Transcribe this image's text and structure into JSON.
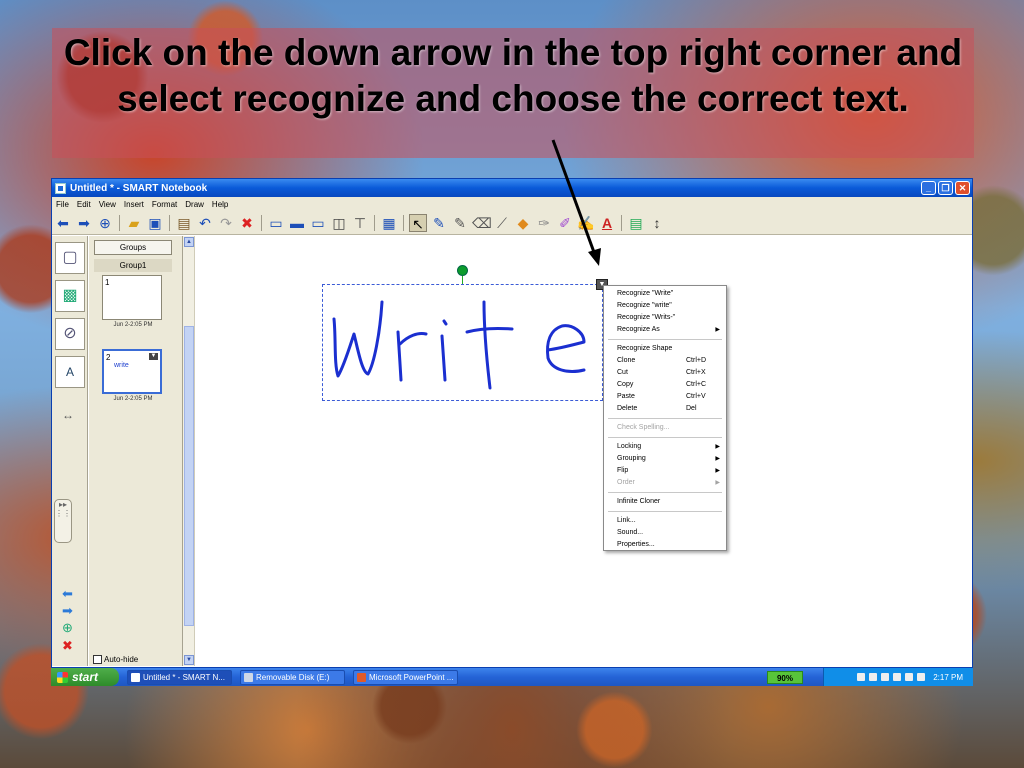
{
  "slide": {
    "instruction": "Click on the down arrow in the top right corner and select recognize and choose the correct text."
  },
  "window": {
    "title": "Untitled * - SMART Notebook",
    "controls": {
      "minimize": "_",
      "restore": "❐",
      "close": "✕"
    },
    "menus": [
      "File",
      "Edit",
      "View",
      "Insert",
      "Format",
      "Draw",
      "Help"
    ]
  },
  "toolbar": {
    "icons": [
      "back-arrow-icon",
      "forward-arrow-icon",
      "add-page-icon",
      "open-folder-icon",
      "save-icon",
      "paste-icon",
      "undo-icon",
      "redo-icon",
      "delete-icon",
      "screen-shade-icon",
      "full-screen-icon",
      "dual-display-icon",
      "capture-icon",
      "document-camera-icon",
      "table-icon",
      "select-icon",
      "pen-icon",
      "creative-pen-icon",
      "eraser-icon",
      "line-icon",
      "shape-icon",
      "fill-icon",
      "magic-pen-icon",
      "shape-recognition-pen-icon",
      "text-icon",
      "properties-icon",
      "move-toolbar-icon"
    ]
  },
  "sorter": {
    "groups_label": "Groups",
    "group_name": "Group1",
    "pages": [
      {
        "number": "1",
        "date": "Jun 2-2:05 PM",
        "content": ""
      },
      {
        "number": "2",
        "date": "Jun 2-2:05 PM",
        "content": "write"
      }
    ],
    "autohide_label": "Auto-hide"
  },
  "canvas": {
    "handwriting": "Write"
  },
  "context_menu": {
    "items": [
      {
        "label": "Recognize \"Write\"",
        "shortcut": "",
        "submenu": false,
        "disabled": false
      },
      {
        "label": "Recognize \"write\"",
        "shortcut": "",
        "submenu": false,
        "disabled": false
      },
      {
        "label": "Recognize \"Writs-\"",
        "shortcut": "",
        "submenu": false,
        "disabled": false
      },
      {
        "label": "Recognize As",
        "shortcut": "",
        "submenu": true,
        "disabled": false
      },
      {
        "sep": true
      },
      {
        "label": "Recognize Shape",
        "shortcut": "",
        "submenu": false,
        "disabled": false
      },
      {
        "label": "Clone",
        "shortcut": "Ctrl+D",
        "submenu": false,
        "disabled": false
      },
      {
        "label": "Cut",
        "shortcut": "Ctrl+X",
        "submenu": false,
        "disabled": false
      },
      {
        "label": "Copy",
        "shortcut": "Ctrl+C",
        "submenu": false,
        "disabled": false
      },
      {
        "label": "Paste",
        "shortcut": "Ctrl+V",
        "submenu": false,
        "disabled": false
      },
      {
        "label": "Delete",
        "shortcut": "Del",
        "submenu": false,
        "disabled": false
      },
      {
        "sep": true
      },
      {
        "label": "Check Spelling...",
        "shortcut": "",
        "submenu": false,
        "disabled": true
      },
      {
        "sep": true
      },
      {
        "label": "Locking",
        "shortcut": "",
        "submenu": true,
        "disabled": false
      },
      {
        "label": "Grouping",
        "shortcut": "",
        "submenu": true,
        "disabled": false
      },
      {
        "label": "Flip",
        "shortcut": "",
        "submenu": true,
        "disabled": false
      },
      {
        "label": "Order",
        "shortcut": "",
        "submenu": true,
        "disabled": true
      },
      {
        "sep": true
      },
      {
        "label": "Infinite Cloner",
        "shortcut": "",
        "submenu": false,
        "disabled": false
      },
      {
        "sep": true
      },
      {
        "label": "Link...",
        "shortcut": "",
        "submenu": false,
        "disabled": false
      },
      {
        "label": "Sound...",
        "shortcut": "",
        "submenu": false,
        "disabled": false
      },
      {
        "label": "Properties...",
        "shortcut": "",
        "submenu": false,
        "disabled": false
      }
    ]
  },
  "taskbar": {
    "start_label": "start",
    "tasks": [
      "Untitled * - SMART N...",
      "Removable Disk (E:)",
      "Microsoft PowerPoint ..."
    ],
    "zoom": "90%",
    "clock": "2:17 PM"
  },
  "colors": {
    "ink": "#1b2fd0",
    "xp_blue": "#0a5ad8",
    "start_green": "#3c9a36",
    "banner": "#c8505a"
  }
}
